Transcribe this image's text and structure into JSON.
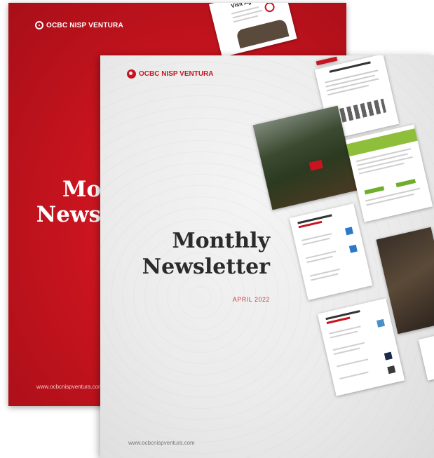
{
  "back_cover": {
    "brand": "OCBC NISP VENTURA",
    "title_line1": "Mo",
    "title_line2": "News",
    "url": "www.ocbcnispventura.com",
    "inset_page_title": "Visit Agenda",
    "background_color": "#c8141f"
  },
  "front_cover": {
    "brand": "OCBC NISP VENTURA",
    "title_line1": "Monthly",
    "title_line2": "Newsletter",
    "date": "APRIL 2022",
    "url": "www.ocbcnispventura.com",
    "background_color": "#ececec",
    "accent_color": "#c8141f"
  }
}
